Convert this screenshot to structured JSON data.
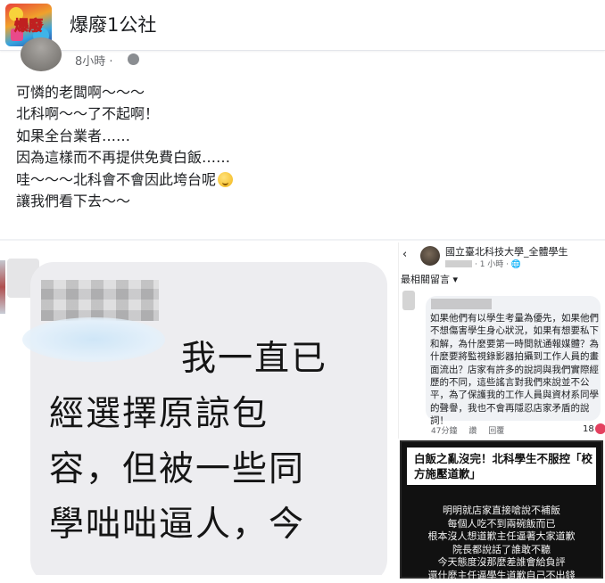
{
  "header": {
    "page_name": "爆廢1公社",
    "logo_text": "爆廢",
    "partial_time": "8小時 ·"
  },
  "post": {
    "lines": [
      "可憐的老闆啊～～～",
      "北科啊～～了不起啊！",
      "如果全台業者……",
      "因為這樣而不再提供免費白飯……",
      "哇～～～北科會不會因此垮台呢",
      "讓我們看下去～～"
    ],
    "emoji": "drooling-face-emoji"
  },
  "left_image": {
    "chat_lines": [
      "我一直已",
      "經選擇原諒包",
      "容，但被一些同",
      "學咄咄逼人，今"
    ]
  },
  "right_image": {
    "back_symbol": "‹",
    "group_name": "國立臺北科技大學_全體學生",
    "sub_meta": "· 1 小時 · 🌐",
    "filter": "最相關留言 ▾",
    "comment": "如果他們有以學生考量為優先，如果他們不想傷害學生身心狀況，如果有想要私下和解，為什麼要第一時間就通報媒體？為什麼要將監視錄影器拍攝到工作人員的畫面流出？店家有許多的說詞與我們實際經歷的不同，這些謠言對我們來說並不公平，為了保護我的工作人員與資材系同學的聲譽，我也不會再隱忍店家矛盾的說詞！",
    "actions": [
      "47分鐘",
      "讚",
      "回覆"
    ],
    "like_count": "18"
  },
  "news_card": {
    "title": "白飯之亂沒完！北科學生不服控「校方施壓道歉」",
    "body_lines": [
      "明明就店家直接嗆說不補飯",
      "每個人吃不到兩碗飯而已",
      "根本沒人想道歉主任逼著大家道歉",
      "院長都說話了誰敢不聽",
      "今天態度沒那麼差誰會給負評",
      "還什麼主任逼學生道歉自己不出錢"
    ]
  },
  "colors": {
    "text": "#1c1e21",
    "meta": "#65676b",
    "bubble": "#ededf0",
    "comment_bg": "#f0f2f5",
    "card_bg": "#111111"
  }
}
